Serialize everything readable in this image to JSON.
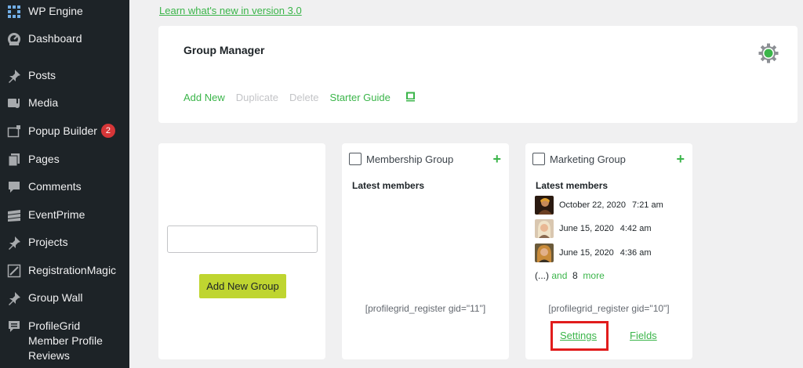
{
  "sidebar": {
    "items": [
      {
        "label": "WP Engine",
        "icon": "wp-engine-grid-icon"
      },
      {
        "label": "Dashboard",
        "icon": "dashboard-gauge-icon"
      },
      {
        "label": "Posts",
        "icon": "pushpin-icon"
      },
      {
        "label": "Media",
        "icon": "media-icon"
      },
      {
        "label": "Popup Builder",
        "icon": "popup-window-icon",
        "badge": "2"
      },
      {
        "label": "Pages",
        "icon": "pages-icon"
      },
      {
        "label": "Comments",
        "icon": "comment-bubble-icon"
      },
      {
        "label": "EventPrime",
        "icon": "eventprime-icon"
      },
      {
        "label": "Projects",
        "icon": "pushpin-icon"
      },
      {
        "label": "RegistrationMagic",
        "icon": "registrationmagic-icon"
      },
      {
        "label": "Group Wall",
        "icon": "pushpin-icon"
      },
      {
        "label": "ProfileGrid Member Profile Reviews",
        "icon": "reviews-icon"
      }
    ]
  },
  "learn_link": "Learn what's new in version 3.0",
  "group_manager": {
    "title": "Group Manager",
    "actions": {
      "add_new": "Add New",
      "duplicate": "Duplicate",
      "delete": "Delete",
      "starter_guide": "Starter Guide"
    }
  },
  "new_group_card": {
    "input_placeholder": "",
    "button_label": "Add New Group"
  },
  "groups": [
    {
      "title": "Membership Group",
      "latest_label": "Latest members",
      "shortcode": "[profilegrid_register gid=\"11\"]"
    },
    {
      "title": "Marketing Group",
      "latest_label": "Latest members",
      "members": [
        {
          "date": "October 22, 2020",
          "time": "7:21 am"
        },
        {
          "date": "June 15, 2020",
          "time": "4:42 am"
        },
        {
          "date": "June 15, 2020",
          "time": "4:36 am"
        }
      ],
      "more_prefix": "(...)",
      "more_and": "and",
      "more_count": "8",
      "more_label": "more",
      "shortcode": "[profilegrid_register gid=\"10\"]",
      "settings_label": "Settings",
      "fields_label": "Fields"
    }
  ],
  "colors": {
    "sidebar_bg": "#1d2327",
    "accent_green": "#3bb54a",
    "button_lime": "#bfd530",
    "badge_red": "#d63638",
    "highlight_red": "#e11c1c"
  }
}
